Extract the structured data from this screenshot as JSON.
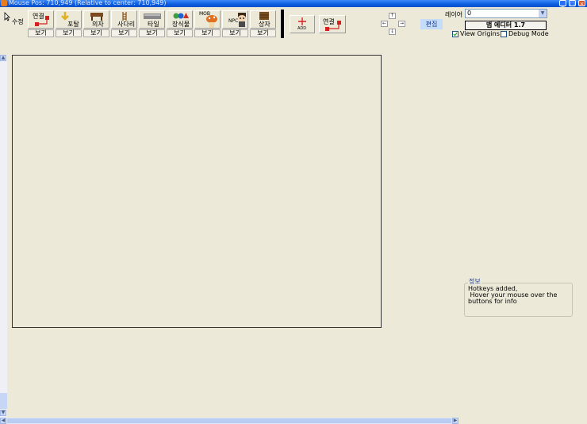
{
  "window": {
    "title": "Mouse Pos: 710,949 (Relative to center: 710,949)"
  },
  "toolbar": {
    "edit_label": "수정",
    "tools": [
      {
        "label": "연결",
        "icon": "connect-icon",
        "view": "보기"
      },
      {
        "label": "포탈",
        "icon": "portal-icon",
        "view": "보기"
      },
      {
        "label": "의자",
        "icon": "chair-icon",
        "view": "보기"
      },
      {
        "label": "사다리",
        "icon": "ladder-icon",
        "view": "보기"
      },
      {
        "label": "타일",
        "icon": "tile-icon",
        "view": "보기"
      },
      {
        "label": "장식물",
        "icon": "decoration-icon",
        "view": "보기"
      },
      {
        "label": "MOB",
        "icon": "mob-icon",
        "view": "보기"
      },
      {
        "label": "NPC",
        "icon": "npc-icon",
        "view": "보기"
      },
      {
        "label": "상자",
        "icon": "box-icon",
        "view": "보기"
      }
    ],
    "add_label": "ADD",
    "connect2_label": "연결"
  },
  "nav": {
    "up": "↑",
    "down": "↓",
    "left": "←",
    "right": "→"
  },
  "edit_toggle": "편집",
  "layer": {
    "label": "레이어",
    "value": "0"
  },
  "editor_button": "맵 에디터 1.7",
  "options": {
    "view_origins": {
      "label": "View Origins",
      "checked": true
    },
    "debug_mode": {
      "label": "Debug Mode",
      "checked": false
    }
  },
  "info": {
    "label": "정보",
    "text": "Hotkeys added,\n Hover your mouse over the buttons for info"
  },
  "colors": {
    "titlebar": "#0a5ce0",
    "background": "#ece9d8",
    "connect_red": "#d62020"
  }
}
